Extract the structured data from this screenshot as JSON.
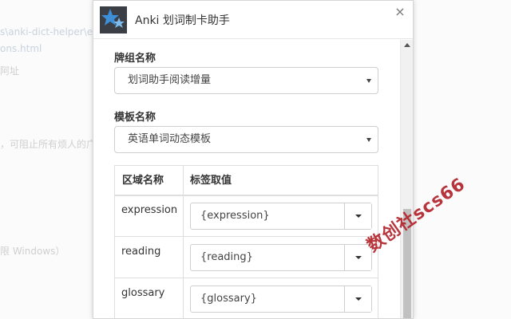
{
  "background": {
    "line1": "s\\anki-dict-helper\\ext",
    "line2": "ons.html",
    "line3": "阿址",
    "line4": "，可阻止所有烦人的广",
    "line5": "限 Windows）"
  },
  "window": {
    "title": "Anki 划词制卡助手",
    "close_symbol": "×",
    "logo_icon": "anki-star-logo"
  },
  "form": {
    "deck_label": "牌组名称",
    "deck_value": "划词助手阅读增量",
    "model_label": "模板名称",
    "model_value": "英语单词动态模板"
  },
  "table": {
    "headers": [
      "区域名称",
      "标签取值"
    ],
    "rows": [
      {
        "name": "expression",
        "value": "{expression}"
      },
      {
        "name": "reading",
        "value": "{reading}"
      },
      {
        "name": "glossary",
        "value": "{glossary}"
      }
    ]
  },
  "watermark": "数创社scs66",
  "colors": {
    "accent_watermark": "#b3242c",
    "logo_blue": "#3d8fd8"
  }
}
